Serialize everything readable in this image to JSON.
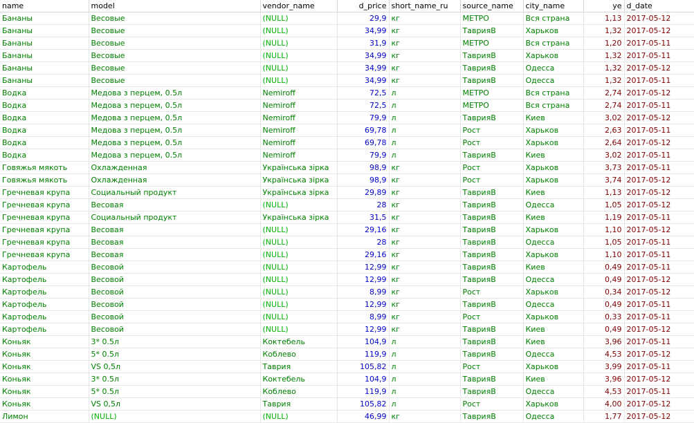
{
  "columns": [
    "name",
    "model",
    "vendor_name",
    "d_price",
    "short_name_ru",
    "source_name",
    "city_name",
    "ye",
    "d_date"
  ],
  "rows": [
    [
      "Бананы",
      "Весовые",
      "(NULL)",
      "29,9",
      "кг",
      "МЕТРО",
      "Вся страна",
      "1,13",
      "2017-05-12"
    ],
    [
      "Бананы",
      "Весовые",
      "(NULL)",
      "34,99",
      "кг",
      "ТаврияВ",
      "Харьков",
      "1,32",
      "2017-05-12"
    ],
    [
      "Бананы",
      "Весовые",
      "(NULL)",
      "31,9",
      "кг",
      "МЕТРО",
      "Вся страна",
      "1,20",
      "2017-05-11"
    ],
    [
      "Бананы",
      "Весовые",
      "(NULL)",
      "34,99",
      "кг",
      "ТаврияВ",
      "Харьков",
      "1,32",
      "2017-05-11"
    ],
    [
      "Бананы",
      "Весовые",
      "(NULL)",
      "34,99",
      "кг",
      "ТаврияВ",
      "Одесса",
      "1,32",
      "2017-05-12"
    ],
    [
      "Бананы",
      "Весовые",
      "(NULL)",
      "34,99",
      "кг",
      "ТаврияВ",
      "Одесса",
      "1,32",
      "2017-05-11"
    ],
    [
      "Водка",
      "Медова з перцем, 0.5л",
      "Nemiroff",
      "72,5",
      "л",
      "МЕТРО",
      "Вся страна",
      "2,74",
      "2017-05-12"
    ],
    [
      "Водка",
      "Медова з перцем, 0.5л",
      "Nemiroff",
      "72,5",
      "л",
      "МЕТРО",
      "Вся страна",
      "2,74",
      "2017-05-11"
    ],
    [
      "Водка",
      "Медова з перцем, 0.5л",
      "Nemiroff",
      "79,9",
      "л",
      "ТаврияВ",
      "Киев",
      "3,02",
      "2017-05-12"
    ],
    [
      "Водка",
      "Медова з перцем, 0.5л",
      "Nemiroff",
      "69,78",
      "л",
      "Рост",
      "Харьков",
      "2,63",
      "2017-05-11"
    ],
    [
      "Водка",
      "Медова з перцем, 0.5л",
      "Nemiroff",
      "69,78",
      "л",
      "Рост",
      "Харьков",
      "2,64",
      "2017-05-12"
    ],
    [
      "Водка",
      "Медова з перцем, 0.5л",
      "Nemiroff",
      "79,9",
      "л",
      "ТаврияВ",
      "Киев",
      "3,02",
      "2017-05-11"
    ],
    [
      "Говяжья мякоть",
      "Охлажденная",
      "Українська зірка",
      "98,9",
      "кг",
      "Рост",
      "Харьков",
      "3,73",
      "2017-05-11"
    ],
    [
      "Говяжья мякоть",
      "Охлажденная",
      "Українська зірка",
      "98,9",
      "кг",
      "Рост",
      "Харьков",
      "3,74",
      "2017-05-12"
    ],
    [
      "Гречневая крупа",
      "Социальный продукт",
      "Українська зірка",
      "29,89",
      "кг",
      "ТаврияВ",
      "Киев",
      "1,13",
      "2017-05-12"
    ],
    [
      "Гречневая крупа",
      "Весовая",
      "(NULL)",
      "28",
      "кг",
      "ТаврияВ",
      "Одесса",
      "1,05",
      "2017-05-12"
    ],
    [
      "Гречневая крупа",
      "Социальный продукт",
      "Українська зірка",
      "31,5",
      "кг",
      "ТаврияВ",
      "Киев",
      "1,19",
      "2017-05-11"
    ],
    [
      "Гречневая крупа",
      "Весовая",
      "(NULL)",
      "29,16",
      "кг",
      "ТаврияВ",
      "Харьков",
      "1,10",
      "2017-05-12"
    ],
    [
      "Гречневая крупа",
      "Весовая",
      "(NULL)",
      "28",
      "кг",
      "ТаврияВ",
      "Одесса",
      "1,05",
      "2017-05-11"
    ],
    [
      "Гречневая крупа",
      "Весовая",
      "(NULL)",
      "29,16",
      "кг",
      "ТаврияВ",
      "Харьков",
      "1,10",
      "2017-05-11"
    ],
    [
      "Картофель",
      "Весовой",
      "(NULL)",
      "12,99",
      "кг",
      "ТаврияВ",
      "Киев",
      "0,49",
      "2017-05-11"
    ],
    [
      "Картофель",
      "Весовой",
      "(NULL)",
      "12,99",
      "кг",
      "ТаврияВ",
      "Одесса",
      "0,49",
      "2017-05-12"
    ],
    [
      "Картофель",
      "Весовой",
      "(NULL)",
      "8,99",
      "кг",
      "Рост",
      "Харьков",
      "0,34",
      "2017-05-12"
    ],
    [
      "Картофель",
      "Весовой",
      "(NULL)",
      "12,99",
      "кг",
      "ТаврияВ",
      "Одесса",
      "0,49",
      "2017-05-11"
    ],
    [
      "Картофель",
      "Весовой",
      "(NULL)",
      "8,99",
      "кг",
      "Рост",
      "Харьков",
      "0,33",
      "2017-05-11"
    ],
    [
      "Картофель",
      "Весовой",
      "(NULL)",
      "12,99",
      "кг",
      "ТаврияВ",
      "Киев",
      "0,49",
      "2017-05-12"
    ],
    [
      "Коньяк",
      "3* 0.5л",
      "Коктебель",
      "104,9",
      "л",
      "ТаврияВ",
      "Киев",
      "3,96",
      "2017-05-11"
    ],
    [
      "Коньяк",
      "5* 0.5л",
      "Коблево",
      "119,9",
      "л",
      "ТаврияВ",
      "Одесса",
      "4,53",
      "2017-05-12"
    ],
    [
      "Коньяк",
      "VS 0,5л",
      "Таврия",
      "105,82",
      "л",
      "Рост",
      "Харьков",
      "3,99",
      "2017-05-11"
    ],
    [
      "Коньяк",
      "3* 0.5л",
      "Коктебель",
      "104,9",
      "л",
      "ТаврияВ",
      "Киев",
      "3,96",
      "2017-05-12"
    ],
    [
      "Коньяк",
      "5* 0.5л",
      "Коблево",
      "119,9",
      "л",
      "ТаврияВ",
      "Одесса",
      "4,53",
      "2017-05-11"
    ],
    [
      "Коньяк",
      "VS 0,5л",
      "Таврия",
      "105,82",
      "л",
      "Рост",
      "Харьков",
      "4,00",
      "2017-05-12"
    ],
    [
      "Лимон",
      "(NULL)",
      "(NULL)",
      "46,99",
      "кг",
      "ТаврияВ",
      "Одесса",
      "1,77",
      "2017-05-12"
    ]
  ]
}
